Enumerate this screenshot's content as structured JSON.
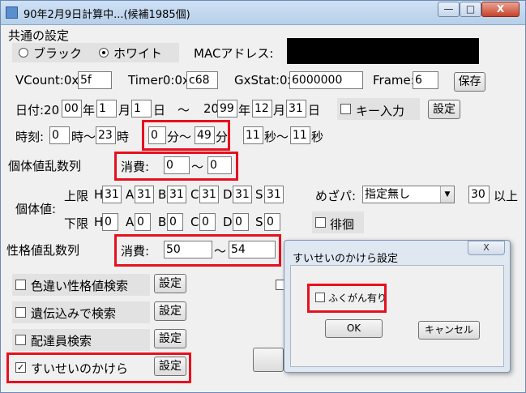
{
  "window": {
    "title": "90年2月9日計算中...(候補1985個)",
    "min_glyph": "—",
    "max_glyph": "□",
    "close_glyph": "X"
  },
  "common": {
    "heading": "共通の設定",
    "radio_black": "ブラック",
    "radio_white": "ホワイト",
    "selected": "ホワイト",
    "mac_label": "MACアドレス:"
  },
  "params": {
    "vcount_label": "VCount:0x",
    "vcount_value": "5f",
    "timer0_label": "Timer0:0x",
    "timer0_value": "c68",
    "gxstat_label": "GxStat:0x",
    "gxstat_value": "6000000",
    "frame_label": "Frame:",
    "frame_value": "6",
    "save_label": "保存"
  },
  "date": {
    "label": "日付:20",
    "start_year": "00",
    "year_unit": "年",
    "start_month": "1",
    "month_unit": "月",
    "start_day": "1",
    "day_unit": "日",
    "tilde": "～",
    "end_prefix": "20",
    "end_year": "99",
    "end_month": "12",
    "end_day": "31",
    "key_input_label": "キー入力",
    "settings_label": "設定"
  },
  "time": {
    "label": "時刻:",
    "hour_from": "0",
    "hour_unit": "時～",
    "hour_to": "23",
    "hour_end_unit": "時",
    "min_from": "0",
    "min_unit": "分～",
    "min_to": "49",
    "min_end_unit": "分",
    "sec_from": "11",
    "sec_unit": "秒～",
    "sec_to": "11",
    "sec_end_unit": "秒"
  },
  "iv_rng": {
    "label": "個体値乱数列",
    "consume_label": "消費:",
    "from": "0",
    "tilde": "～",
    "to": "0"
  },
  "iv": {
    "label": "個体値:",
    "upper_label": "上限",
    "lower_label": "下限",
    "stats": [
      "H",
      "A",
      "B",
      "C",
      "D",
      "S"
    ],
    "upper": [
      "31",
      "31",
      "31",
      "31",
      "31",
      "31"
    ],
    "lower": [
      "0",
      "0",
      "0",
      "0",
      "0",
      "0"
    ]
  },
  "mezapa": {
    "label": "めざパ:",
    "selected": "指定無し",
    "power": "30",
    "suffix": "以上"
  },
  "haikai": {
    "label": "徘徊"
  },
  "pid_rng": {
    "label": "性格値乱数列",
    "consume_label": "消費:",
    "from": "50",
    "tilde": "～",
    "to": "54"
  },
  "options": [
    {
      "label": "色違い性格値検索",
      "checked": false,
      "settings_label": "設定"
    },
    {
      "label": "遺伝込みで検索",
      "checked": false,
      "settings_label": "設定"
    },
    {
      "label": "配達員検索",
      "checked": false,
      "settings_label": "設定"
    },
    {
      "label": "すいせいのかけら",
      "checked": true,
      "settings_label": "設定"
    }
  ],
  "dialog": {
    "title": "すいせいのかけら設定",
    "close_label": "X",
    "fukugan_label": "ふくがん有り",
    "ok_label": "OK",
    "cancel_label": "キャンセル"
  },
  "colors": {
    "highlight": "#e8101e",
    "titlebar": "#b7cfe9",
    "background": "#f0f0f0"
  }
}
